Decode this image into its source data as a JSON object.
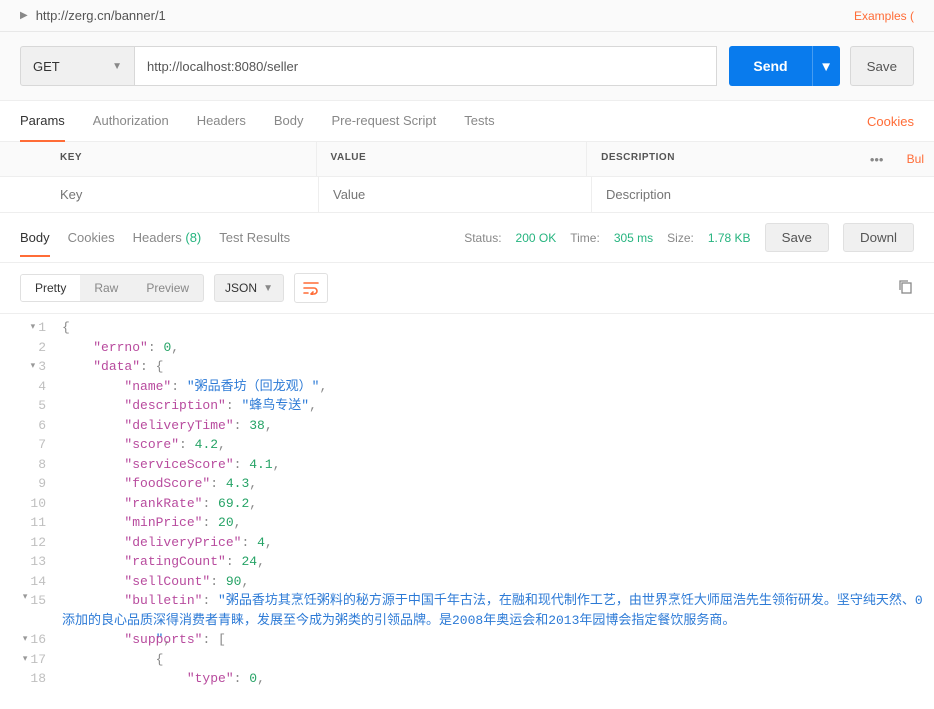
{
  "top": {
    "url": "http://zerg.cn/banner/1",
    "examples": "Examples ("
  },
  "request": {
    "method": "GET",
    "url_value": "http://localhost:8080/seller",
    "send": "Send",
    "save": "Save"
  },
  "tabs": {
    "params": "Params",
    "auth": "Authorization",
    "headers": "Headers",
    "body": "Body",
    "prereq": "Pre-request Script",
    "tests": "Tests",
    "cookies": "Cookies"
  },
  "paramsTable": {
    "key_h": "KEY",
    "value_h": "VALUE",
    "desc_h": "DESCRIPTION",
    "bulk": "Bul",
    "key_p": "Key",
    "value_p": "Value",
    "desc_p": "Description"
  },
  "respTabs": {
    "body": "Body",
    "cookies": "Cookies",
    "headers": "Headers",
    "hcount": "(8)",
    "tests": "Test Results"
  },
  "status": {
    "label": "Status:",
    "code": "200 OK",
    "time_l": "Time:",
    "time_v": "305 ms",
    "size_l": "Size:",
    "size_v": "1.78 KB",
    "save": "Save",
    "download": "Downl"
  },
  "viewBar": {
    "pretty": "Pretty",
    "raw": "Raw",
    "preview": "Preview",
    "json": "JSON"
  },
  "responseJson": {
    "errno": 0,
    "data": {
      "name": "粥品香坊（回龙观）",
      "description": "蜂鸟专送",
      "deliveryTime": 38,
      "score": 4.2,
      "serviceScore": 4.1,
      "foodScore": 4.3,
      "rankRate": 69.2,
      "minPrice": 20,
      "deliveryPrice": 4,
      "ratingCount": 24,
      "sellCount": 90,
      "bulletin": "粥品香坊其烹饪粥料的秘方源于中国千年古法，在融和现代制作工艺，由世界烹饪大师屈浩先生领衔研发。坚守纯天然、0添加的良心品质深得消费者青睐，发展至今成为粥类的引领品牌。是2008年奥运会和2013年园博会指定餐饮服务商。",
      "supports_first_type": 0
    }
  },
  "lineNumbers": [
    "1",
    "2",
    "3",
    "4",
    "5",
    "6",
    "7",
    "8",
    "9",
    "10",
    "11",
    "12",
    "13",
    "14",
    "15",
    "16",
    "17",
    "18"
  ],
  "foldLines": [
    1,
    3,
    15,
    16,
    17
  ]
}
